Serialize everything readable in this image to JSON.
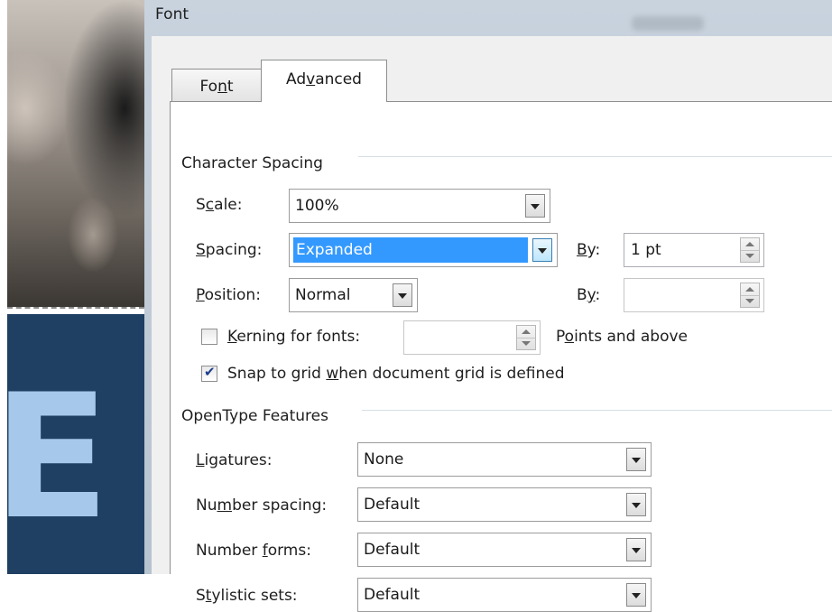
{
  "dialog": {
    "title": "Font"
  },
  "tabs": [
    {
      "pre": "Fo",
      "ul": "n",
      "post": "t",
      "selected": false
    },
    {
      "pre": "Ad",
      "ul": "v",
      "post": "anced",
      "selected": true
    }
  ],
  "character_spacing": {
    "title": "Character Spacing",
    "scale": {
      "pre": "S",
      "ul": "c",
      "post": "ale:",
      "value": "100%"
    },
    "spacing": {
      "pre": "",
      "ul": "S",
      "post": "pacing:",
      "value": "Expanded",
      "by_pre": "",
      "by_ul": "B",
      "by_post": "y:",
      "by_value": "1 pt"
    },
    "position": {
      "pre": "",
      "ul": "P",
      "post": "osition:",
      "value": "Normal",
      "by_pre": "B",
      "by_ul": "y",
      "by_post": ":",
      "by_value": ""
    },
    "kerning": {
      "pre": "",
      "ul": "K",
      "post": "erning for fonts:",
      "checked": false,
      "value": "",
      "suffix_pre": "P",
      "suffix_ul": "o",
      "suffix_post": "ints and above"
    },
    "snap": {
      "pre": "Snap to grid ",
      "ul": "w",
      "post": "hen document grid is defined",
      "checked": true
    }
  },
  "opentype": {
    "title": "OpenType Features",
    "ligatures": {
      "pre": "",
      "ul": "L",
      "post": "igatures:",
      "value": "None"
    },
    "number_spacing": {
      "pre": "Nu",
      "ul": "m",
      "post": "ber spacing:",
      "value": "Default"
    },
    "number_forms": {
      "pre": "Number ",
      "ul": "f",
      "post": "orms:",
      "value": "Default"
    },
    "stylistic_sets": {
      "pre": "S",
      "ul": "t",
      "post": "ylistic sets:",
      "value": "Default"
    }
  },
  "colors": {
    "selection": "#3399ff",
    "poster": "#1f3f63",
    "poster_letter": "#a6c8ea"
  },
  "icons": {
    "dropdown": "chevron-down-icon",
    "spinner": "spin-arrows-icon",
    "check": "checkmark-icon"
  },
  "background": {
    "poster_letter": "E"
  }
}
